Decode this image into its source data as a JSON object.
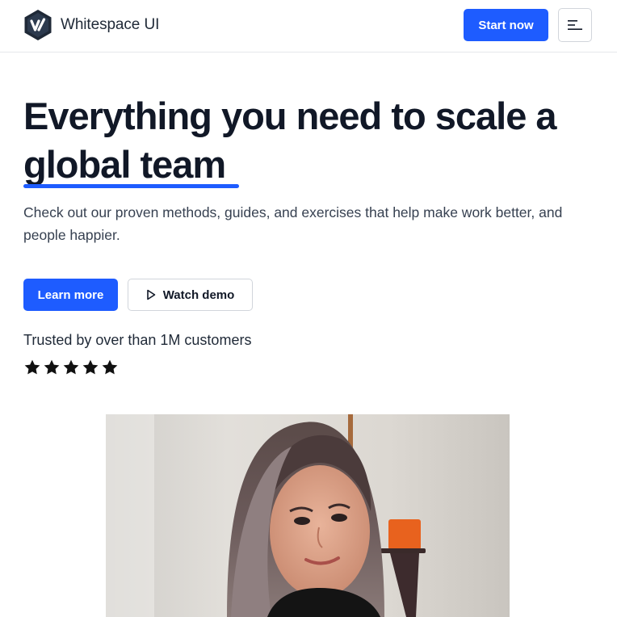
{
  "navbar": {
    "brand_name": "Whitespace UI",
    "logo_icon": "whitespace-hexagon-logo",
    "cta_label": "Start now",
    "menu_icon": "hamburger-menu-icon"
  },
  "hero": {
    "headline": "Everything you need to scale a global team",
    "subtext": "Check out our proven methods, guides, and exercises that help make work better, and people happier.",
    "primary_button": "Learn more",
    "secondary_button": "Watch demo",
    "secondary_icon": "play-icon",
    "trust_text": "Trusted by over than 1M customers",
    "rating": {
      "value": 5,
      "max": 5
    }
  },
  "colors": {
    "accent": "#1e5cff",
    "text": "#111827",
    "border": "#e5e7eb"
  },
  "hero_image": {
    "subject": "portrait-photo"
  }
}
